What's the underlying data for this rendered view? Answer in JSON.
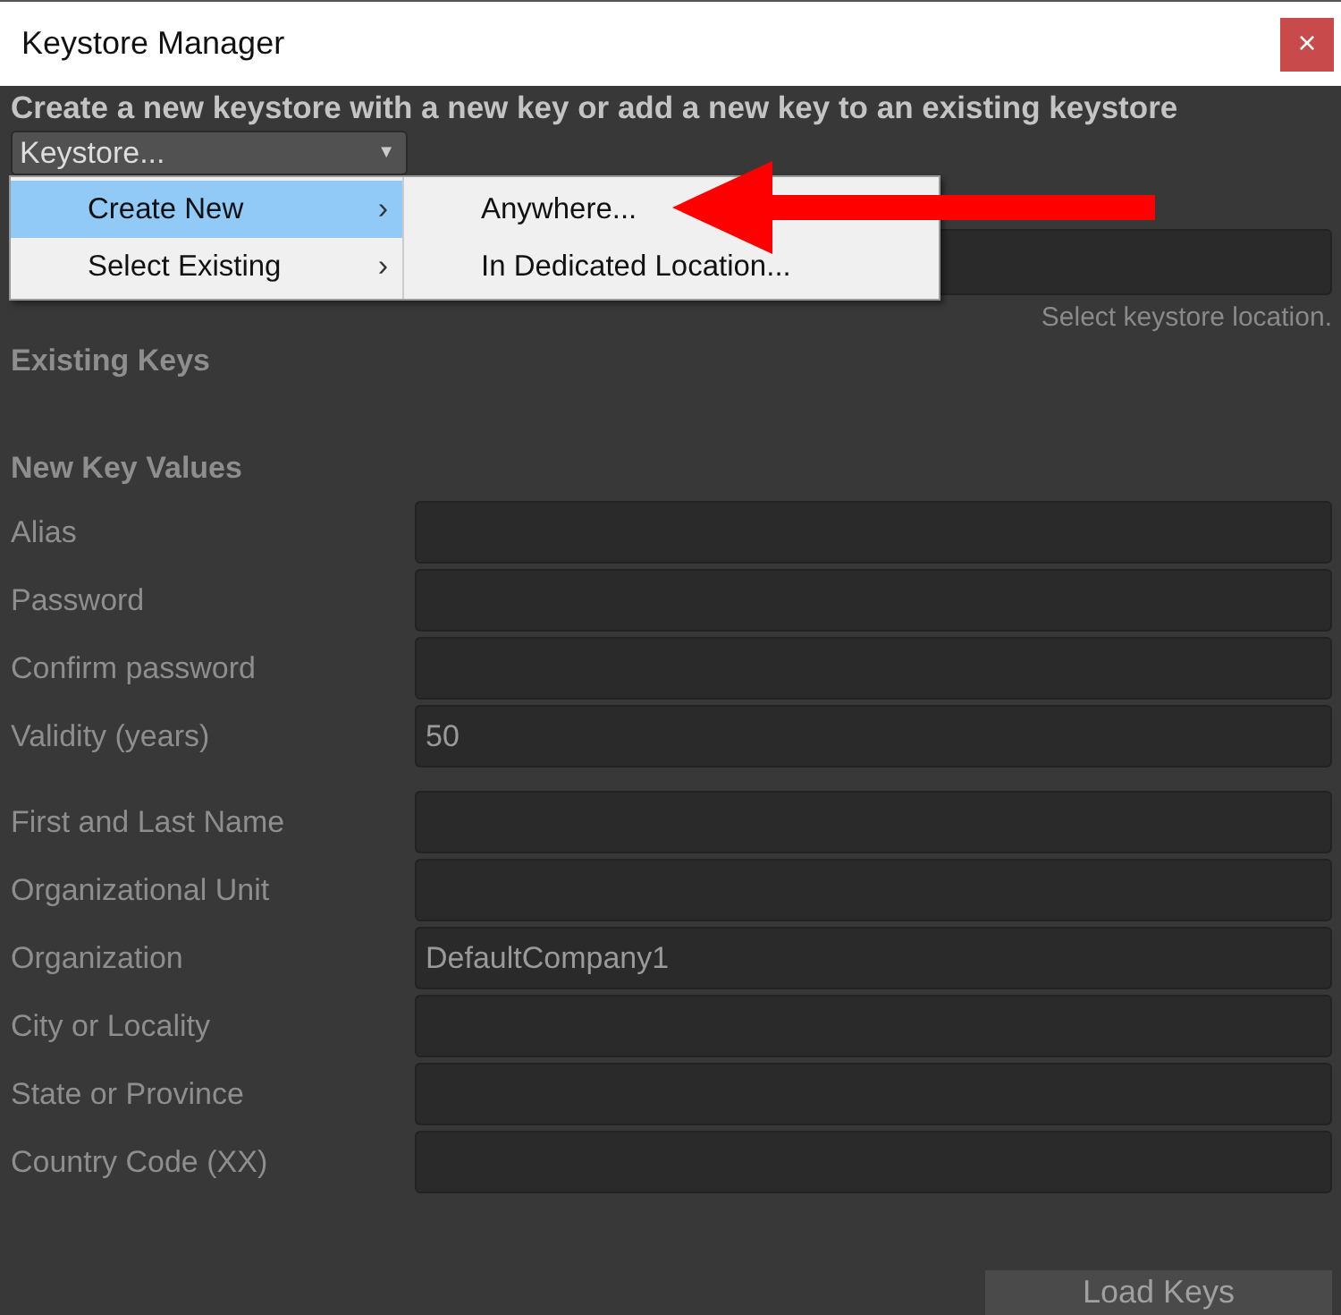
{
  "window": {
    "title": "Keystore Manager",
    "close": "×"
  },
  "header": "Create a new keystore with a new key or add a new key to an existing keystore",
  "keystore_dropdown": {
    "value": "Keystore...",
    "caret": "▼"
  },
  "menu": {
    "items": [
      {
        "label": "Create New",
        "arrow": "›",
        "selected": true
      },
      {
        "label": "Select Existing",
        "arrow": "›",
        "selected": false
      }
    ],
    "submenu": [
      {
        "label": "Anywhere..."
      },
      {
        "label": "In Dedicated Location..."
      }
    ]
  },
  "location_hint": "Select keystore location.",
  "existing_keys_heading": "Existing Keys",
  "new_key_heading": "New Key Values",
  "field_groups": [
    [
      {
        "label": "Alias"
      },
      {
        "label": "Password"
      },
      {
        "label": "Confirm password"
      },
      {
        "label": "Validity (years)",
        "value": "50"
      }
    ],
    [
      {
        "label": "First and Last Name"
      },
      {
        "label": "Organizational Unit"
      },
      {
        "label": "Organization",
        "value": "DefaultCompany1"
      },
      {
        "label": "City or Locality"
      },
      {
        "label": "State or Province"
      },
      {
        "label": "Country Code (XX)"
      }
    ]
  ],
  "load_button": "Load Keys"
}
